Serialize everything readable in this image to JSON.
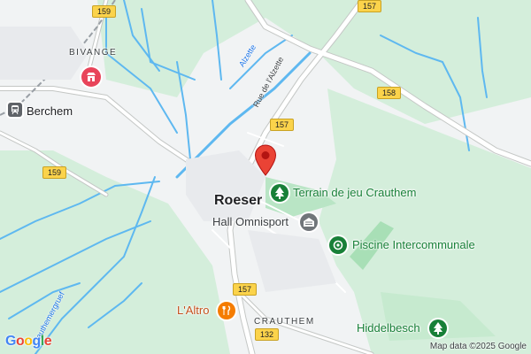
{
  "map": {
    "place_labels": {
      "roeser": "Roeser",
      "berchem": "Berchem",
      "bivange": "BIVANGE",
      "crauthem": "CRAUTHEM"
    },
    "poi_labels": {
      "terrain_de_jeu": "Terrain de jeu Crauthem",
      "hall_omnisport": "Hall Omnisport",
      "piscine": "Piscine Intercommunale",
      "laltro": "L'Altro",
      "hiddelbesch": "Hiddelbesch"
    },
    "water_labels": {
      "alzette": "Alzette",
      "crauthemergrouf": "Crauthemergruef"
    },
    "street_labels": {
      "rue_alzette": "Rue de l'Alzette"
    },
    "road_shields": {
      "r159_top": "159",
      "r157_top": "157",
      "r158": "158",
      "r157_mid": "157",
      "r159_left": "159",
      "r157_bottom": "157",
      "r132": "132"
    },
    "icons": {
      "pin": "location-pin-icon",
      "tree": "park-tree-icon",
      "sports_hall": "sports-hall-icon",
      "swimming": "swimming-pool-icon",
      "restaurant": "restaurant-icon",
      "shop": "store-icon",
      "train": "train-station-icon"
    },
    "colors": {
      "land": "#f1f3f4",
      "green": "#d4eedb",
      "park": "#b9e5c5",
      "water": "#5eb8f0",
      "road": "#ffffff",
      "road_casing": "#c4c7c5",
      "pin": "#ea4335",
      "poi_green": "#188038",
      "poi_gray": "#70757a",
      "poi_orange": "#f57c00",
      "shop_red": "#e8445a"
    }
  },
  "branding": {
    "logo": "Google",
    "attribution": "Map data ©2025 Google"
  }
}
